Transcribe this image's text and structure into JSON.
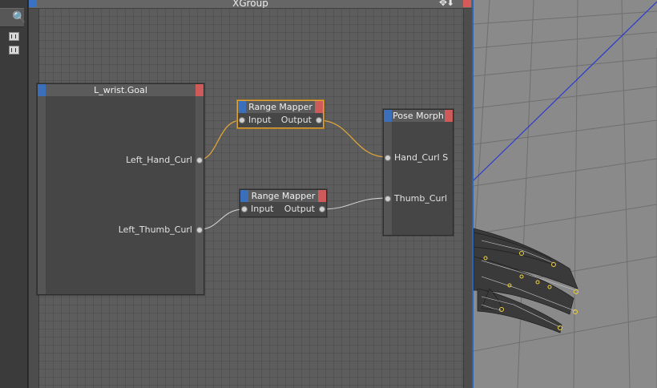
{
  "editor": {
    "title": "XGroup"
  },
  "nodes": {
    "goal": {
      "title": "L_wrist.Goal",
      "ports": [
        "Left_Hand_Curl",
        "Left_Thumb_Curl"
      ]
    },
    "mapper1": {
      "title": "Range Mapper",
      "input": "Input",
      "output": "Output"
    },
    "mapper2": {
      "title": "Range Mapper",
      "input": "Input",
      "output": "Output"
    },
    "pose": {
      "title": "Pose Morph",
      "ports": [
        "Hand_Curl S",
        "Thumb_Curl"
      ]
    }
  },
  "colors": {
    "selected_wire": "#e0a53a",
    "plain_wire": "#d9d9d9",
    "input_tab": "#3b6fba",
    "output_tab": "#cf5a5a"
  },
  "icons": [
    "search-icon",
    "layer-icon",
    "layer-icon",
    "move-icon",
    "download-icon"
  ]
}
